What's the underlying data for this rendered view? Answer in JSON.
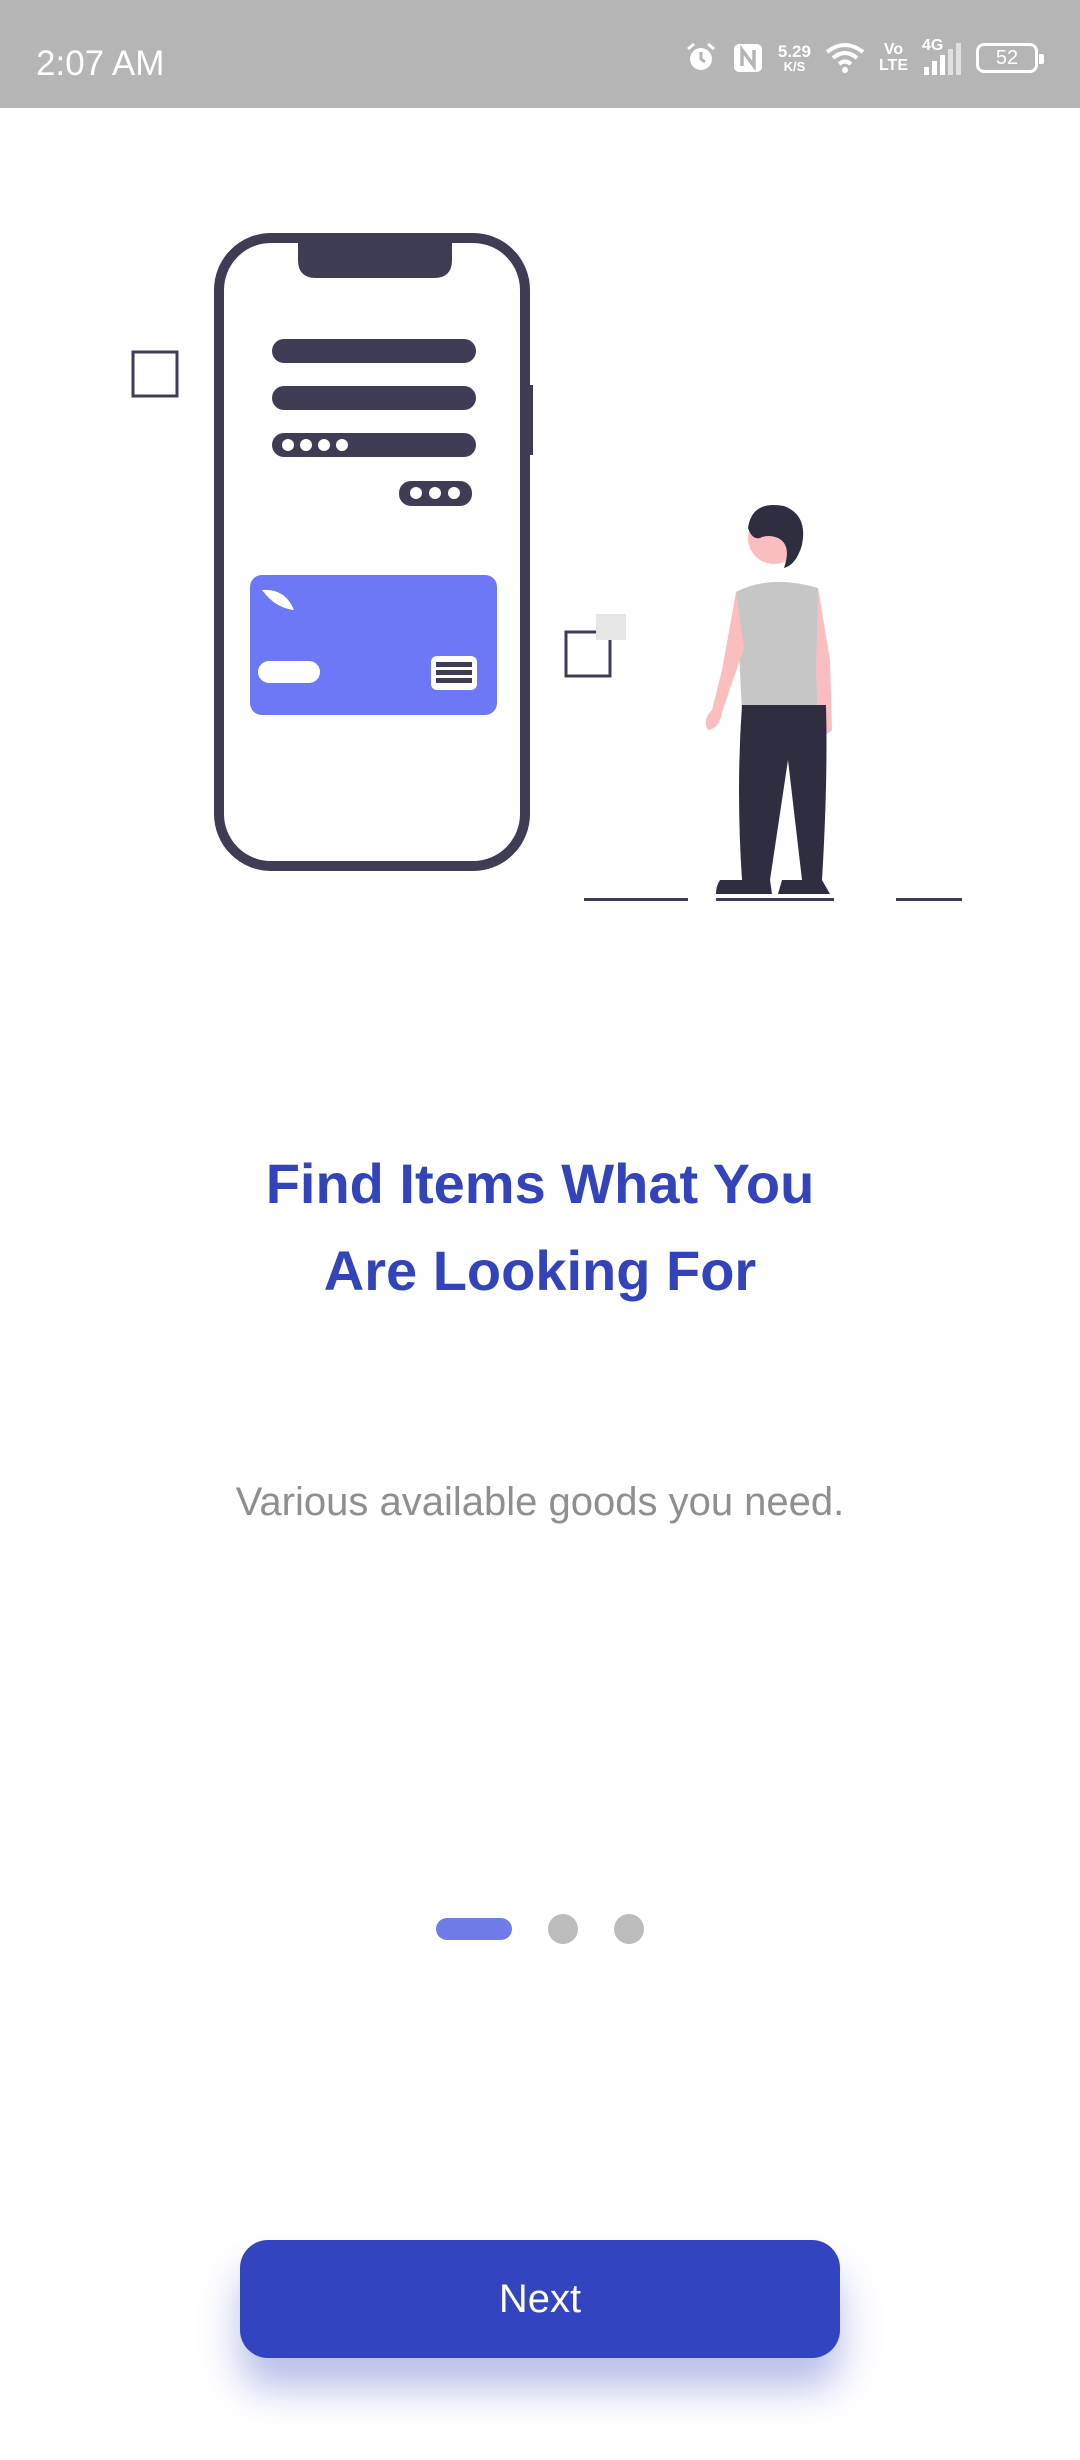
{
  "status_bar": {
    "time": "2:07 AM",
    "speed_value": "5.29",
    "speed_unit": "K/S",
    "volte_top": "Vo",
    "volte_bottom": "LTE",
    "network": "4G",
    "battery": "52"
  },
  "onboarding": {
    "title": "Find Items What You Are Looking For",
    "subtitle": "Various available goods you need.",
    "page_indicator": {
      "total": 3,
      "current": 1
    },
    "next_label": "Next"
  },
  "colors": {
    "accent": "#3344c1",
    "title": "#3344bb",
    "card": "#6c78f5",
    "dark": "#2f2e41"
  }
}
